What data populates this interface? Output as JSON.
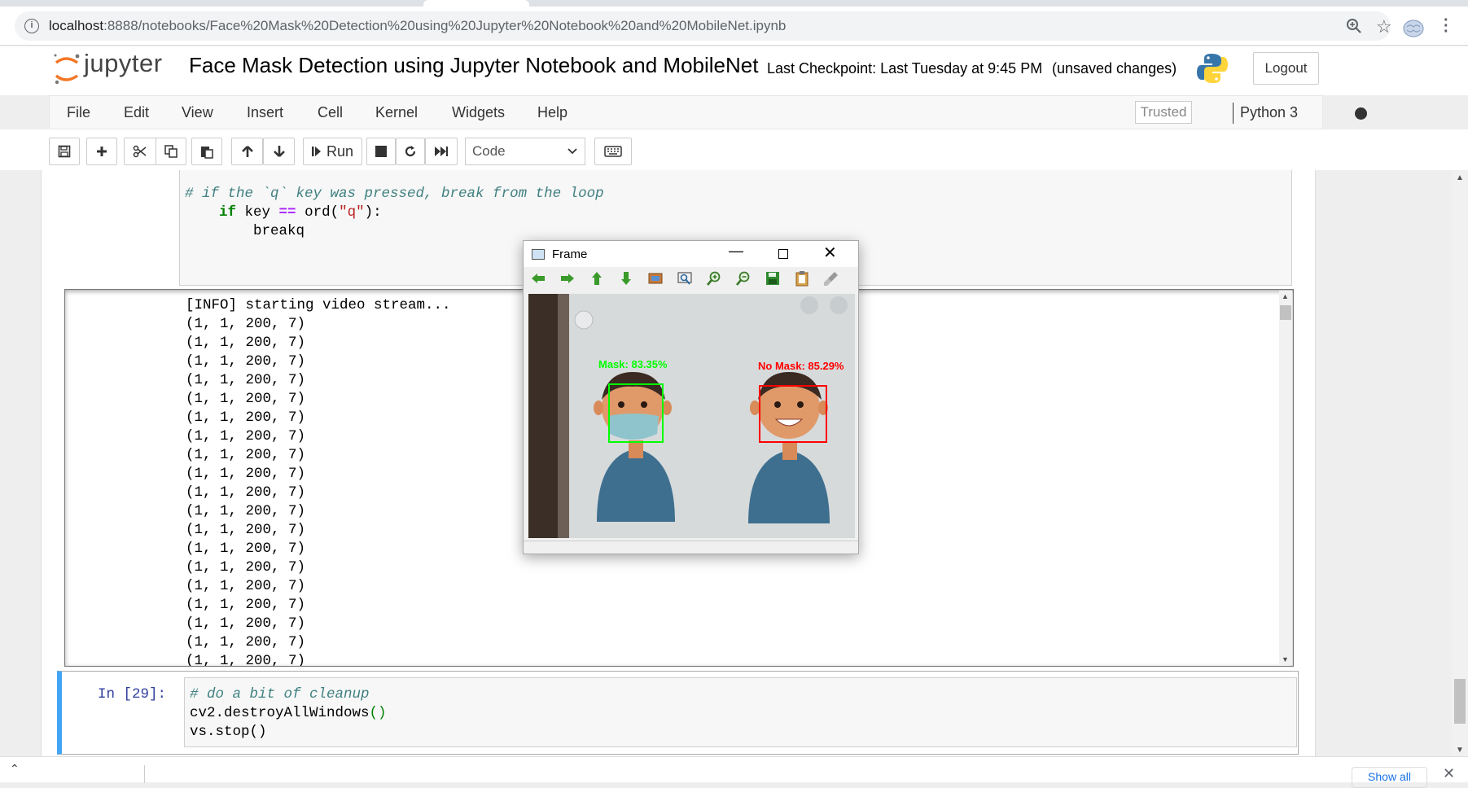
{
  "browser": {
    "url_host": "localhost",
    "url_path": ":8888/notebooks/Face%20Mask%20Detection%20using%20Jupyter%20Notebook%20and%20MobileNet.ipynb"
  },
  "header": {
    "logo_text": "jupyter",
    "notebook_title": "Face Mask Detection using Jupyter Notebook and MobileNet",
    "checkpoint": "Last Checkpoint: Last Tuesday at 9:45 PM",
    "unsaved": "(unsaved changes)",
    "logout_label": "Logout"
  },
  "menubar": {
    "items": [
      "File",
      "Edit",
      "View",
      "Insert",
      "Cell",
      "Kernel",
      "Widgets",
      "Help"
    ],
    "trusted_label": "Trusted",
    "kernel_name": "Python 3"
  },
  "toolbar": {
    "run_label": "Run",
    "cell_type": "Code"
  },
  "cell1": {
    "line1": "# if the `q` key was pressed, break from the loop",
    "line2_kw": "if",
    "line2_a": " key ",
    "line2_op": "==",
    "line2_b": " ord(",
    "line2_str": "\"q\"",
    "line2_c": "):",
    "line3": "breakq"
  },
  "output": {
    "first_line": "[INFO] starting video stream...",
    "repeated_line": "(1, 1, 200, 7)",
    "repeat_count": 19
  },
  "cell2": {
    "prompt": "In [29]:",
    "line1": "# do a bit of cleanup",
    "line2_a": "cv2.destroyAllWindows",
    "line2_paren": "()",
    "line3": "vs.stop()"
  },
  "frame_window": {
    "title": "Frame",
    "mask_label": "Mask: 83.35%",
    "no_mask_label": "No Mask: 85.29%"
  },
  "downloadbar": {
    "show_all_label": "Show all"
  },
  "colors": {
    "mask_box": "#00ff00",
    "no_mask_box": "#ff0000",
    "cell_selected": "#42a5f5"
  }
}
